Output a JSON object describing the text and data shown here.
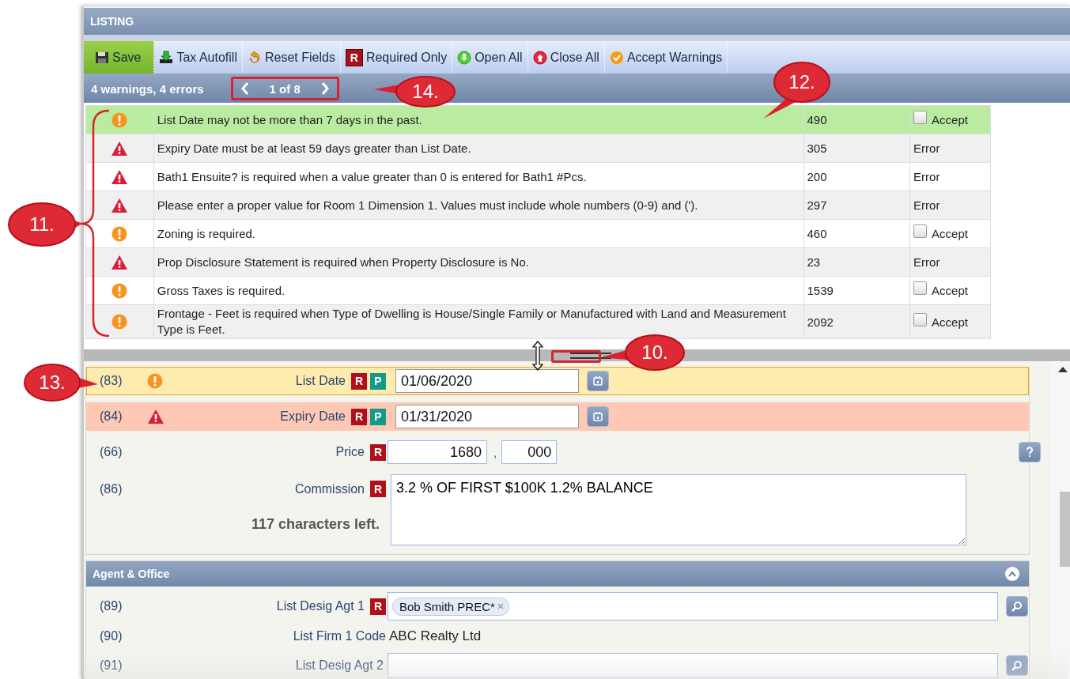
{
  "window": {
    "title": "LISTING"
  },
  "toolbar": [
    {
      "kind": "save",
      "label": "Save",
      "primary": true
    },
    {
      "kind": "download",
      "label": "Tax Autofill",
      "primary": false
    },
    {
      "kind": "reset",
      "label": "Reset Fields",
      "primary": false
    },
    {
      "kind": "required",
      "badge": "R",
      "label": "Required Only",
      "primary": false
    },
    {
      "kind": "open",
      "label": "Open All",
      "primary": false
    },
    {
      "kind": "close",
      "label": "Close All",
      "primary": false
    },
    {
      "kind": "accept",
      "label": "Accept Warnings",
      "primary": false
    }
  ],
  "summary": {
    "text": "4 warnings, 4 errors",
    "page": "1 of 8"
  },
  "messages": [
    {
      "kind": "warning",
      "text": "List Date may not be more than 7 days in the past.",
      "code": "490",
      "status": {
        "kind": "accept",
        "label": "Accept",
        "checked": false
      },
      "selected": true
    },
    {
      "kind": "error",
      "text": "Expiry Date must be at least 59 days greater than List Date.",
      "code": "305",
      "status": {
        "kind": "error",
        "label": "Error"
      },
      "selected": false
    },
    {
      "kind": "error",
      "text": "Bath1 Ensuite? is required when a value greater than 0 is entered for Bath1 #Pcs.",
      "code": "200",
      "status": {
        "kind": "error",
        "label": "Error"
      },
      "selected": false
    },
    {
      "kind": "error",
      "text": "Please enter a proper value for Room 1 Dimension 1. Values must include whole numbers (0-9) and (').",
      "code": "297",
      "status": {
        "kind": "error",
        "label": "Error"
      },
      "selected": false
    },
    {
      "kind": "warning",
      "text": "Zoning is required.",
      "code": "460",
      "status": {
        "kind": "accept",
        "label": "Accept",
        "checked": false
      },
      "selected": false
    },
    {
      "kind": "error",
      "text": "Prop Disclosure Statement is required when Property Disclosure is No.",
      "code": "23",
      "status": {
        "kind": "error",
        "label": "Error"
      },
      "selected": false
    },
    {
      "kind": "warning",
      "text": "Gross Taxes is required.",
      "code": "1539",
      "status": {
        "kind": "accept",
        "label": "Accept",
        "checked": false
      },
      "selected": false
    },
    {
      "kind": "warning",
      "text": "Frontage - Feet is required when Type of Dwelling is House/Single Family or Manufactured with Land and Measurement Type is Feet.",
      "code": "2092",
      "status": {
        "kind": "accept",
        "label": "Accept",
        "checked": false
      },
      "selected": false
    }
  ],
  "fields": [
    {
      "kind": "date",
      "number": "(83)",
      "warning": true,
      "error": false,
      "label": "List Date",
      "badges": [
        {
          "text": "R",
          "color": "#b0101c"
        },
        {
          "text": "P",
          "color": "#139a8a"
        }
      ],
      "value": "01/06/2020"
    },
    {
      "kind": "date",
      "number": "(84)",
      "warning": false,
      "error": true,
      "label": "Expiry Date",
      "badges": [
        {
          "text": "R",
          "color": "#b0101c"
        },
        {
          "text": "P",
          "color": "#139a8a"
        }
      ],
      "value": "01/31/2020"
    },
    {
      "kind": "price",
      "number": "(66)",
      "label": "Price",
      "badges": [
        {
          "text": "R",
          "color": "#b0101c"
        }
      ],
      "value": "1680",
      "separator": ",",
      "cents": "000",
      "help": true
    },
    {
      "kind": "textarea",
      "number": "(86)",
      "label": "Commission",
      "badges": [
        {
          "text": "R",
          "color": "#b0101c"
        }
      ],
      "value": "3.2 % OF FIRST $100K 1.2% BALANCE",
      "note": "117 characters left."
    }
  ],
  "sections": [
    {
      "title": "Agent & Office",
      "expanded": true,
      "fields": [
        {
          "kind": "tags",
          "number": "(89)",
          "label": "List Desig Agt 1",
          "badges": [
            {
              "text": "R",
              "color": "#b0101c"
            }
          ],
          "tags": [
            "Bob Smith PREC*"
          ]
        },
        {
          "kind": "static",
          "number": "(90)",
          "label": "List Firm 1 Code",
          "value": "ABC Realty Ltd"
        },
        {
          "kind": "lookup",
          "number": "(91)",
          "label": "List Desig Agt 2"
        }
      ]
    }
  ],
  "callouts": [
    {
      "label": "14."
    },
    {
      "label": "12."
    },
    {
      "label": "11."
    },
    {
      "label": "10."
    },
    {
      "label": "13."
    }
  ]
}
